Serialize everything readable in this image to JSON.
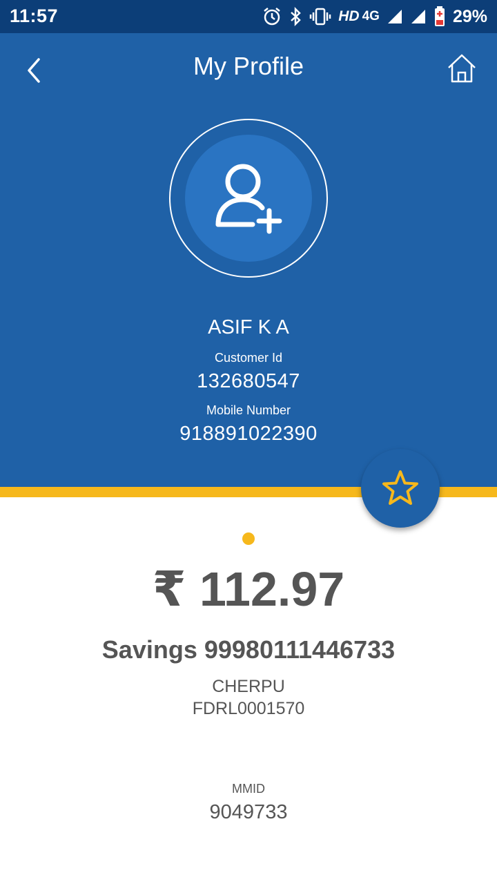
{
  "status_bar": {
    "time": "11:57",
    "network": "HD",
    "network_gen": "4G",
    "battery": "29%"
  },
  "header": {
    "title": "My Profile"
  },
  "profile": {
    "name": "ASIF K A",
    "customer_id_label": "Customer Id",
    "customer_id": "132680547",
    "mobile_label": "Mobile Number",
    "mobile": "918891022390"
  },
  "account": {
    "balance": "₹ 112.97",
    "account_line": "Savings 99980111446733",
    "branch": "CHERPU",
    "ifsc": "FDRL0001570",
    "mmid_label": "MMID",
    "mmid": "9049733"
  },
  "colors": {
    "header_bg": "#1f61a7",
    "status_bg": "#0c3e78",
    "accent": "#f6b81c",
    "text_gray": "#555555"
  },
  "icons": [
    "back-icon",
    "home-icon",
    "add-user-icon",
    "star-icon",
    "alarm-icon",
    "bluetooth-icon",
    "vibrate-icon",
    "signal-icon",
    "battery-icon"
  ]
}
